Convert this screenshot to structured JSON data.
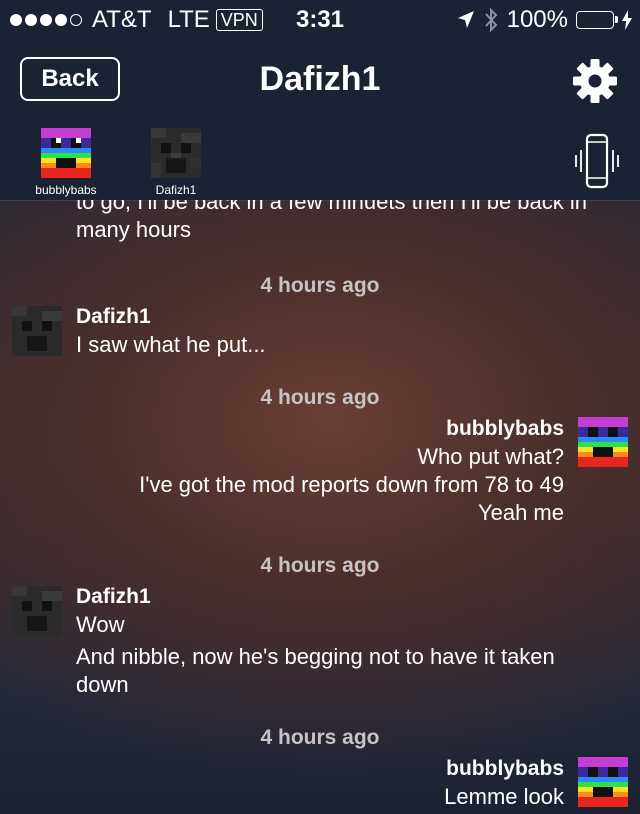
{
  "status_bar": {
    "carrier": "AT&T",
    "network": "LTE",
    "vpn": "VPN",
    "time": "3:31",
    "battery": "100%",
    "signal_bars_filled": 4,
    "battery_level": 1.0
  },
  "nav": {
    "back_label": "Back",
    "title": "Dafizh1",
    "members": [
      {
        "name": "bubblybabs"
      },
      {
        "name": "Dafizh1"
      }
    ]
  },
  "chat": {
    "partial_text": "to go, I'll be back in a few minuets then I'll be back in many hours",
    "blocks": [
      {
        "timestamp": "4 hours ago",
        "sender": "Dafizh1",
        "side": "left",
        "lines": [
          "I saw what he put..."
        ]
      },
      {
        "timestamp": "4 hours ago",
        "sender": "bubblybabs",
        "side": "right",
        "lines": [
          "Who put what?",
          "I've got the mod reports down from 78 to 49",
          "Yeah me"
        ]
      },
      {
        "timestamp": "4 hours ago",
        "sender": "Dafizh1",
        "side": "left",
        "lines": [
          "Wow",
          "And nibble, now he's begging not to have it taken down"
        ]
      },
      {
        "timestamp": "4 hours ago",
        "sender": "bubblybabs",
        "side": "right",
        "lines": [
          "Lemme look"
        ]
      }
    ]
  },
  "colors": {
    "bar_bg": "#1b2233",
    "battery_green": "#4cd964",
    "timestamp_text": "#c9c3c6"
  },
  "icons": [
    "location-arrow-icon",
    "bluetooth-icon",
    "charging-bolt-icon",
    "gear-icon",
    "vibrate-phone-icon"
  ]
}
